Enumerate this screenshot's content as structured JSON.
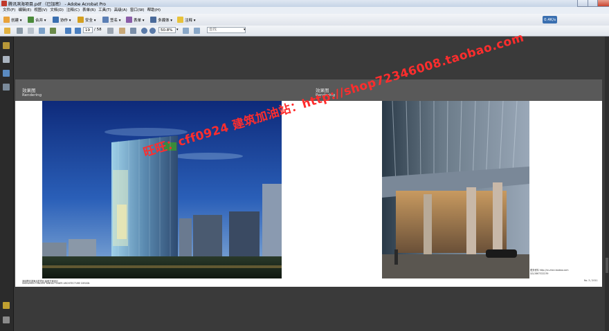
{
  "window": {
    "title": "腾讯滨海项目.pdf （已加密） - Adobe Acrobat Pro"
  },
  "menu": [
    "文件(F)",
    "编辑(E)",
    "视图(V)",
    "文档(D)",
    "注释(C)",
    "表单(R)",
    "工具(T)",
    "高级(A)",
    "窗口(W)",
    "帮助(H)"
  ],
  "toolbar1": {
    "create": "创建 ▾",
    "combine": "合并 ▾",
    "collaborate": "协作 ▾",
    "secure": "安全 ▾",
    "sign": "签名 ▾",
    "forms": "表单 ▾",
    "multimedia": "多媒体 ▾",
    "comment": "注释 ▾",
    "badge": "0.4K/s"
  },
  "toolbar2": {
    "page_current": "19",
    "page_total": "/ 58",
    "zoom": "50.8%",
    "find_placeholder": "查找"
  },
  "page": {
    "left_title": "效果图",
    "left_subtitle": "Rendering",
    "right_title": "效果图",
    "right_subtitle": "Rendering",
    "footer_left_line1": "深圳腾讯滨海大厦项目 建筑方案设计",
    "footer_left_line2": "SHENZHEN TENCENT BINHAI TOWER ARCHITECTURE DESIGN",
    "footer_right_line1": "更多资料 http://ut-zhan.taobao.com",
    "footer_right_line2": "QQ:2867322239",
    "footer_page": "No. 3 / 2011"
  },
  "watermark": "旺旺：cff0924  建筑加油站：http://shop72346008.taobao.com",
  "colors": {
    "workspace": "#3a3a3a",
    "page_header": "#595959",
    "watermark": "#ff2d2d"
  }
}
